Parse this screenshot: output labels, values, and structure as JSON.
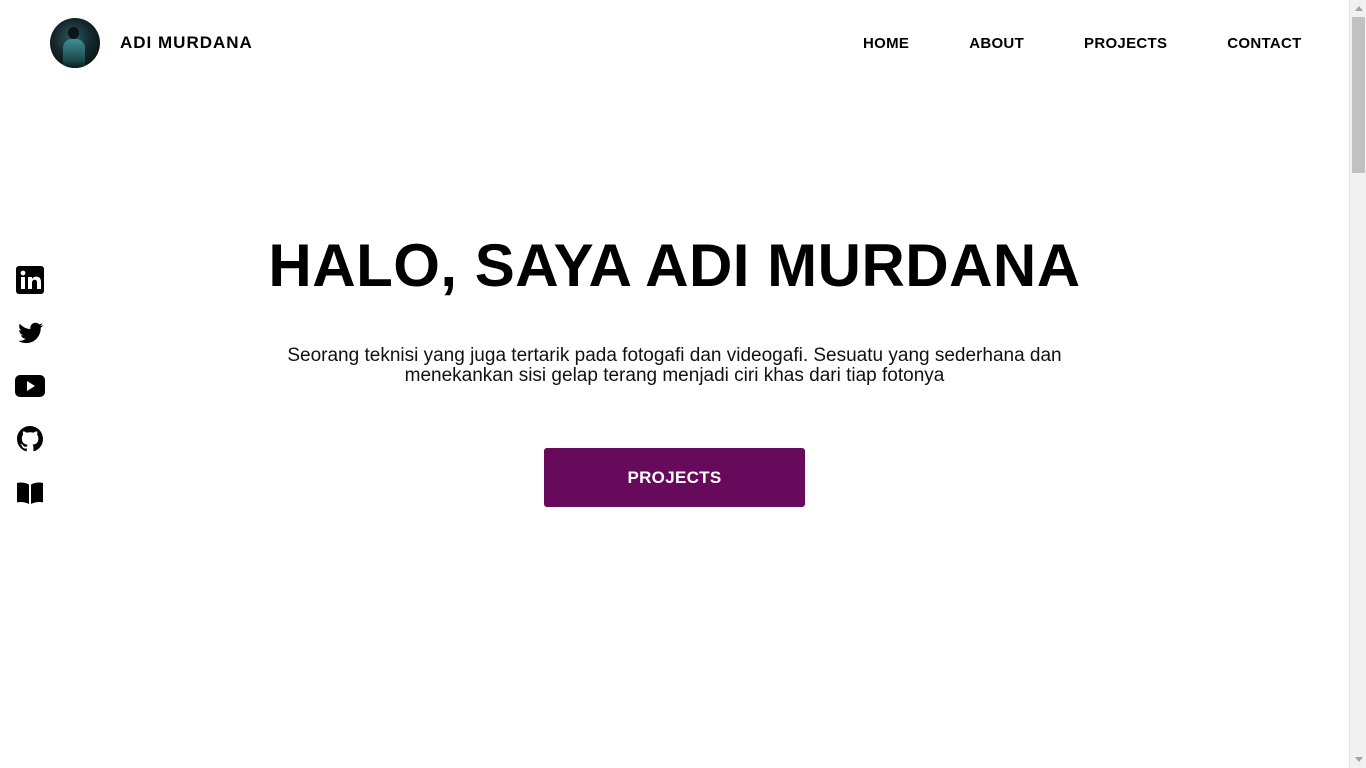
{
  "header": {
    "brand_name": "ADI MURDANA",
    "nav": [
      {
        "label": "HOME"
      },
      {
        "label": "ABOUT"
      },
      {
        "label": "PROJECTS"
      },
      {
        "label": "CONTACT"
      }
    ]
  },
  "social": [
    {
      "icon": "linkedin-icon"
    },
    {
      "icon": "twitter-icon"
    },
    {
      "icon": "youtube-icon"
    },
    {
      "icon": "github-icon"
    },
    {
      "icon": "book-icon"
    }
  ],
  "hero": {
    "title": "HALO, SAYA ADI MURDANA",
    "description": "Seorang teknisi yang juga tertarik pada fotogafi dan videogafi. Sesuatu yang sederhana dan menekankan sisi gelap terang menjadi ciri khas dari tiap fotonya",
    "cta_label": "PROJECTS"
  },
  "colors": {
    "accent": "#670a5c",
    "text": "#000000",
    "background": "#ffffff"
  }
}
